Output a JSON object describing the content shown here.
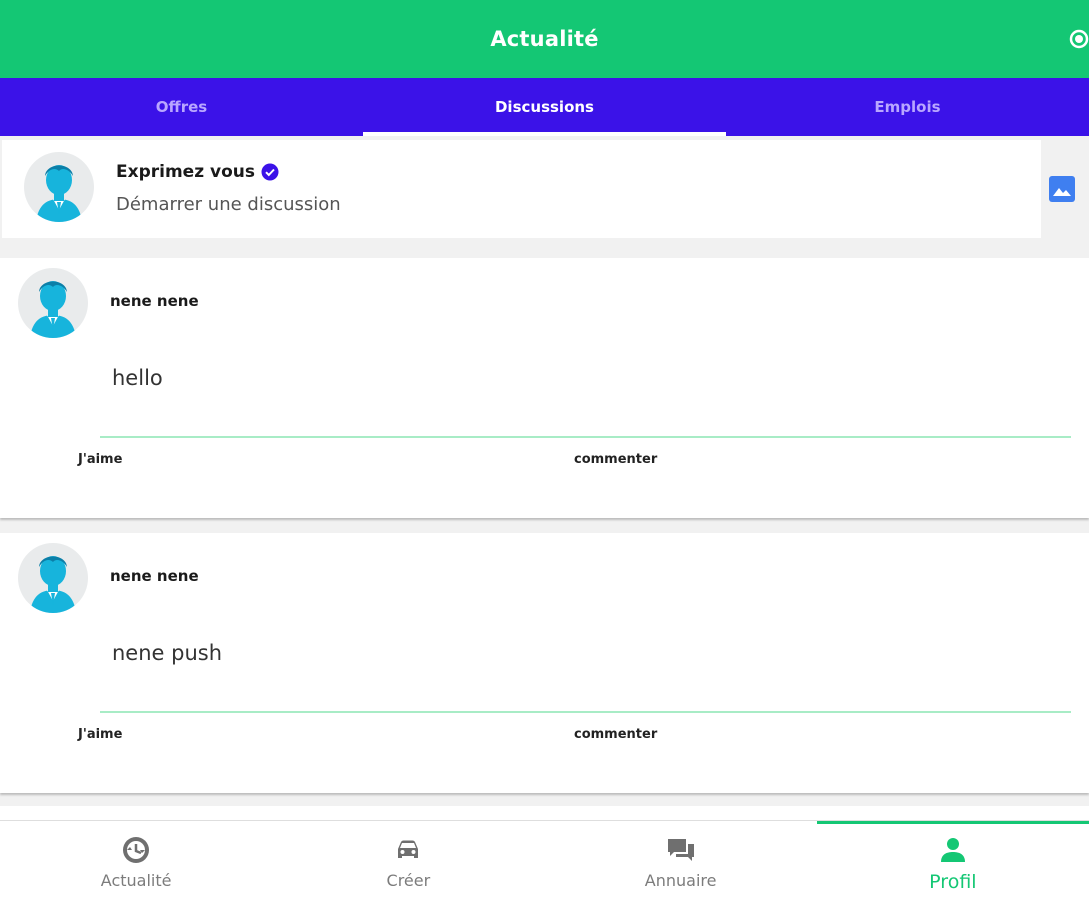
{
  "header": {
    "title": "Actualité"
  },
  "tabs": [
    {
      "label": "Offres",
      "active": false
    },
    {
      "label": "Discussions",
      "active": true
    },
    {
      "label": "Emplois",
      "active": false
    }
  ],
  "composer": {
    "heading": "Exprimez vous",
    "prompt": "Démarrer une discussion"
  },
  "posts": [
    {
      "author": "nene nene",
      "body": "hello",
      "like_label": "J'aime",
      "comment_label": "commenter"
    },
    {
      "author": "nene nene",
      "body": "nene push",
      "like_label": "J'aime",
      "comment_label": "commenter"
    }
  ],
  "bottom_nav": [
    {
      "label": "Actualité",
      "icon": "news-icon",
      "active": false
    },
    {
      "label": "Créer",
      "icon": "car-icon",
      "active": false
    },
    {
      "label": "Annuaire",
      "icon": "chat-bubbles-icon",
      "active": false
    },
    {
      "label": "Profil",
      "icon": "person-icon",
      "active": true
    }
  ],
  "colors": {
    "header": "#14c774",
    "tab_bar": "#3b12e8",
    "accent": "#14c774",
    "verified": "#3b12e8",
    "image_icon": "#3f7ff0"
  }
}
